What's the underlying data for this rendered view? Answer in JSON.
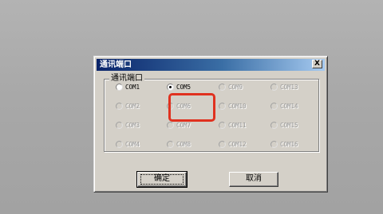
{
  "dialog": {
    "title": "通讯端口",
    "close_label": "X",
    "group_label": "通讯端口",
    "ports": [
      {
        "label": "COM1",
        "selected": false,
        "enabled": true
      },
      {
        "label": "COM2",
        "selected": false,
        "enabled": false
      },
      {
        "label": "COM3",
        "selected": false,
        "enabled": false
      },
      {
        "label": "COM4",
        "selected": false,
        "enabled": false
      },
      {
        "label": "COM5",
        "selected": true,
        "enabled": true
      },
      {
        "label": "COM6",
        "selected": false,
        "enabled": false
      },
      {
        "label": "COM7",
        "selected": false,
        "enabled": false
      },
      {
        "label": "COM8",
        "selected": false,
        "enabled": false
      },
      {
        "label": "COM9",
        "selected": false,
        "enabled": false
      },
      {
        "label": "COM10",
        "selected": false,
        "enabled": false
      },
      {
        "label": "COM11",
        "selected": false,
        "enabled": false
      },
      {
        "label": "COM12",
        "selected": false,
        "enabled": false
      },
      {
        "label": "COM13",
        "selected": false,
        "enabled": false
      },
      {
        "label": "COM14",
        "selected": false,
        "enabled": false
      },
      {
        "label": "COM15",
        "selected": false,
        "enabled": false
      },
      {
        "label": "COM16",
        "selected": false,
        "enabled": false
      }
    ],
    "ok_label": "确定",
    "cancel_label": "取消"
  },
  "colors": {
    "title_bar": "#0a246a",
    "dialog_face": "#d4d0c8",
    "highlight": "#e0311f",
    "backdrop": "#a9a9a9"
  },
  "icons": {
    "close": "close-icon"
  }
}
